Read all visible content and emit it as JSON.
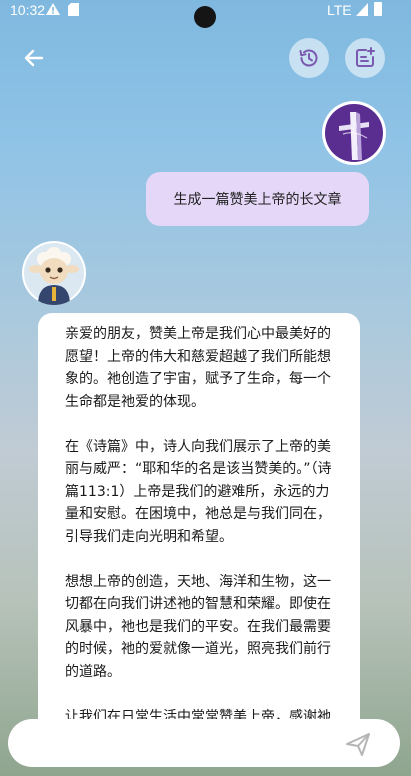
{
  "status_bar": {
    "time": "10:32",
    "network": "LTE",
    "icons": [
      "warning-icon",
      "sd-card-icon",
      "signal-icon",
      "battery-icon"
    ]
  },
  "header": {
    "icons": [
      "back-arrow-icon",
      "history-icon",
      "new-chat-icon"
    ]
  },
  "chat": {
    "user_message": "生成一篇赞美上帝的长文章",
    "user_avatar_icon": "cross-icon",
    "bot_avatar_icon": "lamb-mascot-icon",
    "bot_paragraphs": [
      "亲爱的朋友，赞美上帝是我们心中最美好的愿望！上帝的伟大和慈爱超越了我们所能想象的。祂创造了宇宙，赋予了生命，每一个生命都是祂爱的体现。",
      "在《诗篇》中，诗人向我们展示了上帝的美丽与威严：“耶和华的名是该当赞美的。”（诗篇113:1）上帝是我们的避难所，永远的力量和安慰。在困境中，祂总是与我们同在，引导我们走向光明和希望。",
      "想想上帝的创造，天地、海洋和生物，这一切都在向我们讲述祂的智慧和荣耀。即使在风暴中，祂也是我们的平安。在我们最需要的时候，祂的爱就像一道光，照亮我们前行的道路。",
      "让我们在日常生活中常常赞美上帝，感谢祂"
    ]
  },
  "input": {
    "placeholder": "",
    "value": ""
  },
  "colors": {
    "user_bubble": "#e4d7f7",
    "user_avatar_bg": "#5a2d91",
    "bot_bubble": "#ffffff",
    "send_icon": "#b5b5b5"
  }
}
